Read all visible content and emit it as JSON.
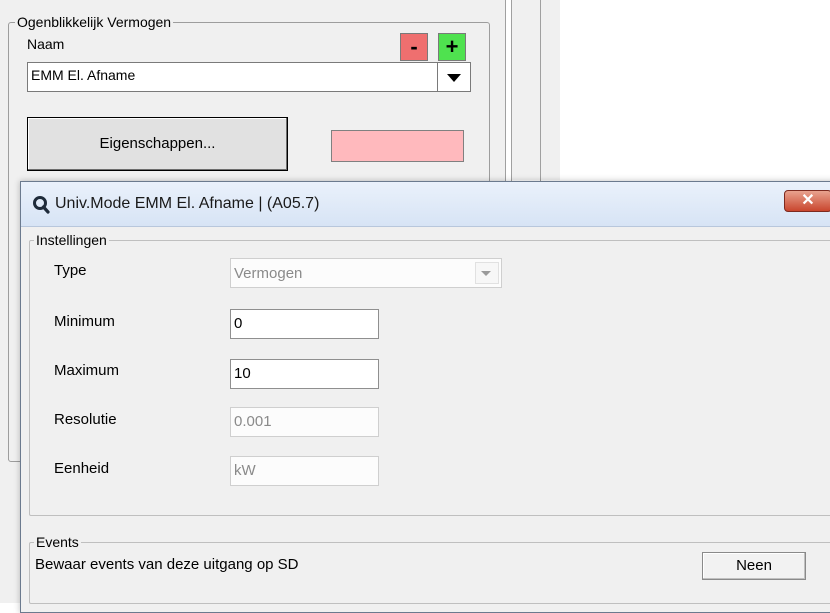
{
  "background_window": {
    "group_title": "Ogenblikkelijk Vermogen",
    "name_label": "Naam",
    "minus_label": "-",
    "plus_label": "+",
    "name_value": "EMM El. Afname",
    "properties_label": "Eigenschappen...",
    "colors": {
      "minus": "#ef6f6f",
      "plus": "#4fe24f",
      "swatch": "#ffb9bd"
    }
  },
  "dialog": {
    "title": "Univ.Mode EMM El. Afname |  (A05.7)",
    "title_icon": "search-icon",
    "close_label": "✕",
    "settings": {
      "legend": "Instellingen",
      "type_label": "Type",
      "type_value": "Vermogen",
      "minimum_label": "Minimum",
      "minimum_value": "0",
      "maximum_label": "Maximum",
      "maximum_value": "10",
      "resolution_label": "Resolutie",
      "resolution_value": "0.001",
      "unit_label": "Eenheid",
      "unit_value": "kW"
    },
    "events": {
      "legend": "Events",
      "description": "Bewaar events van deze uitgang op SD",
      "button_label": "Neen"
    }
  }
}
